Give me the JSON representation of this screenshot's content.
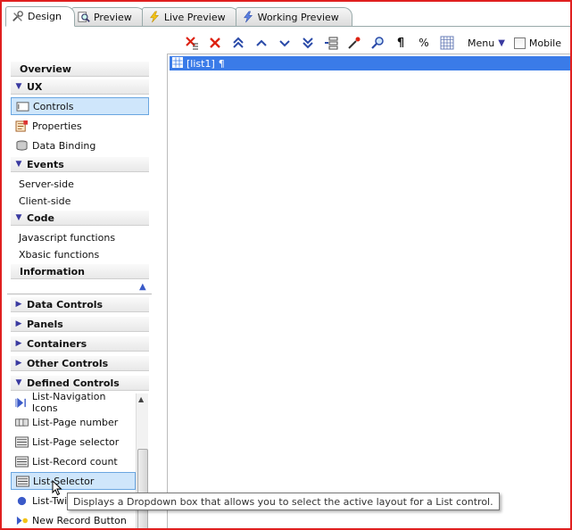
{
  "tabs": [
    {
      "label": "Design",
      "icon": "tools-icon",
      "active": true
    },
    {
      "label": "Preview",
      "icon": "magnify-page-icon"
    },
    {
      "label": "Live Preview",
      "icon": "lightning-icon"
    },
    {
      "label": "Working Preview",
      "icon": "lightning-icon"
    }
  ],
  "toolbar": {
    "buttons": [
      "cut-delete-icon",
      "delete-icon",
      "move-top-icon",
      "move-up-icon",
      "move-down-icon",
      "move-bottom-icon",
      "indent-icon",
      "edit-wand-icon",
      "find-icon",
      "pilcrow-icon",
      "percent-icon",
      "grid-icon"
    ],
    "pilcrow": "¶",
    "percent": "%",
    "menu_label": "Menu",
    "mobile_label": "Mobile"
  },
  "left": {
    "overview": "Overview",
    "ux": "UX",
    "controls": "Controls",
    "properties": "Properties",
    "data_binding": "Data Binding",
    "events": "Events",
    "server_side": "Server-side",
    "client_side": "Client-side",
    "code": "Code",
    "js_functions": "Javascript functions",
    "xbasic_functions": "Xbasic functions",
    "information": "Information",
    "data_controls": "Data Controls",
    "panels": "Panels",
    "containers": "Containers",
    "other_controls": "Other Controls",
    "defined_controls": "Defined Controls",
    "defined_items": [
      "List-Navigation Icons",
      "List-Page number",
      "List-Page selector",
      "List-Record count",
      "List-Selector",
      "List-Twit",
      "New Record Button"
    ]
  },
  "canvas": {
    "selected_row": "[list1]",
    "pilcrow": "¶"
  },
  "tooltip": "Displays a Dropdown box that allows you to select the active layout for a List control.",
  "colors": {
    "frame_border": "#e02020",
    "selection": "#3a7be8",
    "selected_item_bg": "#cfe6fb"
  }
}
